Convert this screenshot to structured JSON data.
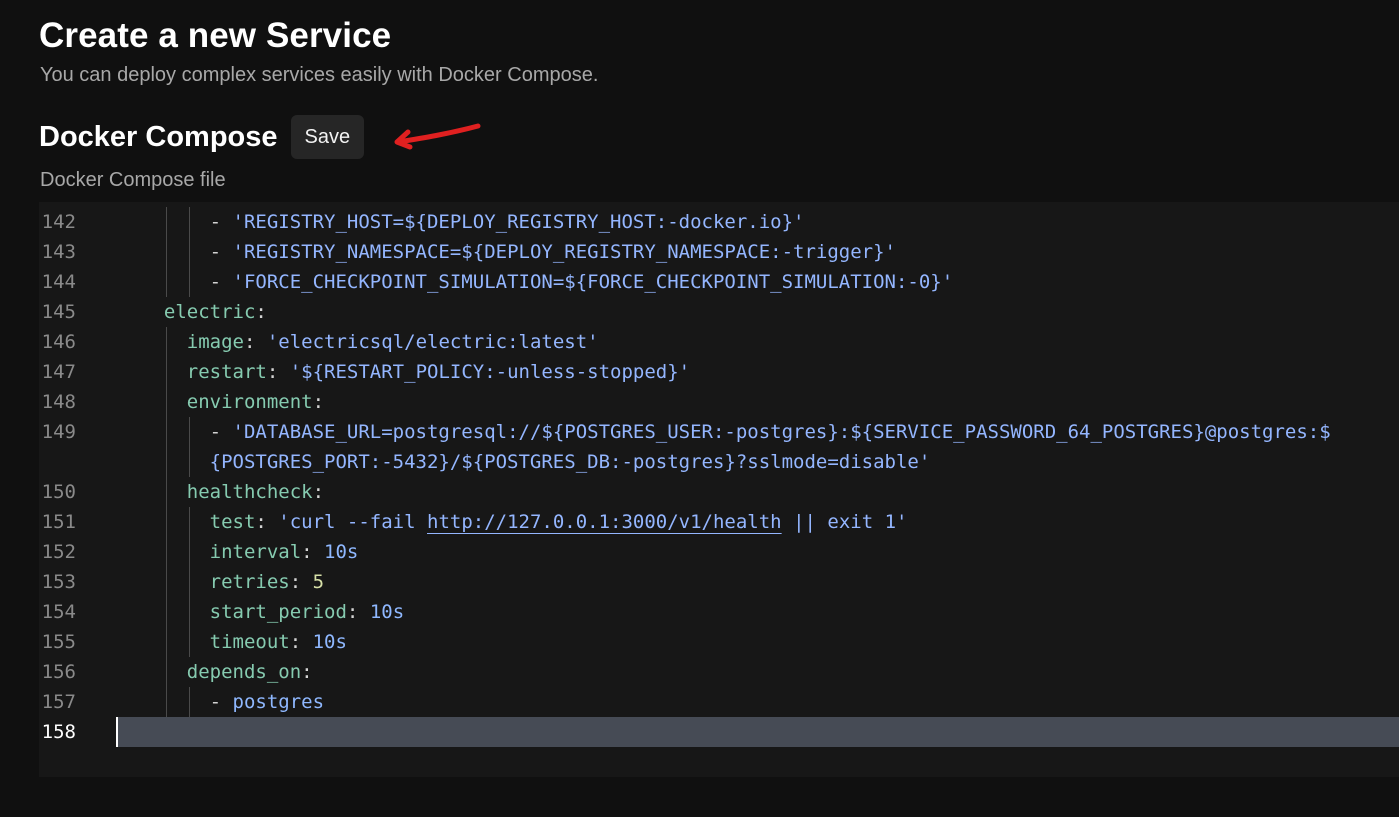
{
  "page": {
    "title": "Create a new Service",
    "subtitle": "You can deploy complex services easily with Docker Compose."
  },
  "section": {
    "title": "Docker Compose",
    "save_label": "Save",
    "annotation_color": "#e02020"
  },
  "editor": {
    "label": "Docker Compose file",
    "active_line": "158",
    "lines": [
      {
        "num": "142",
        "indent": "      ",
        "parts": [
          [
            "p",
            "- "
          ],
          [
            "s",
            "'REGISTRY_HOST=${DEPLOY_REGISTRY_HOST:-docker.io}'"
          ]
        ]
      },
      {
        "num": "143",
        "indent": "      ",
        "parts": [
          [
            "p",
            "- "
          ],
          [
            "s",
            "'REGISTRY_NAMESPACE=${DEPLOY_REGISTRY_NAMESPACE:-trigger}'"
          ]
        ]
      },
      {
        "num": "144",
        "indent": "      ",
        "parts": [
          [
            "p",
            "- "
          ],
          [
            "s",
            "'FORCE_CHECKPOINT_SIMULATION=${FORCE_CHECKPOINT_SIMULATION:-0}'"
          ]
        ]
      },
      {
        "num": "145",
        "indent": "  ",
        "parts": [
          [
            "k",
            "electric"
          ],
          [
            "p",
            ":"
          ]
        ]
      },
      {
        "num": "146",
        "indent": "    ",
        "parts": [
          [
            "k",
            "image"
          ],
          [
            "p",
            ": "
          ],
          [
            "s",
            "'electricsql/electric:latest'"
          ]
        ]
      },
      {
        "num": "147",
        "indent": "    ",
        "parts": [
          [
            "k",
            "restart"
          ],
          [
            "p",
            ": "
          ],
          [
            "s",
            "'${RESTART_POLICY:-unless-stopped}'"
          ]
        ]
      },
      {
        "num": "148",
        "indent": "    ",
        "parts": [
          [
            "k",
            "environment"
          ],
          [
            "p",
            ":"
          ]
        ]
      },
      {
        "num": "149",
        "indent": "      ",
        "parts": [
          [
            "p",
            "- "
          ],
          [
            "s",
            "'DATABASE_URL=postgresql://${POSTGRES_USER:-postgres}:${SERVICE_PASSWORD_64_POSTGRES}@postgres:$"
          ]
        ]
      },
      {
        "num": "",
        "indent": "      ",
        "parts": [
          [
            "s",
            "{POSTGRES_PORT:-5432}/${POSTGRES_DB:-postgres}?sslmode=disable'"
          ]
        ]
      },
      {
        "num": "150",
        "indent": "    ",
        "parts": [
          [
            "k",
            "healthcheck"
          ],
          [
            "p",
            ":"
          ]
        ]
      },
      {
        "num": "151",
        "indent": "      ",
        "parts": [
          [
            "k",
            "test"
          ],
          [
            "p",
            ": "
          ],
          [
            "s",
            "'curl --fail "
          ],
          [
            "su",
            "http://127.0.0.1:3000/v1/health"
          ],
          [
            "s",
            " || exit 1'"
          ]
        ]
      },
      {
        "num": "152",
        "indent": "      ",
        "parts": [
          [
            "k",
            "interval"
          ],
          [
            "p",
            ": "
          ],
          [
            "n",
            "10s"
          ]
        ]
      },
      {
        "num": "153",
        "indent": "      ",
        "parts": [
          [
            "k",
            "retries"
          ],
          [
            "p",
            ": "
          ],
          [
            "g",
            "5"
          ]
        ]
      },
      {
        "num": "154",
        "indent": "      ",
        "parts": [
          [
            "k",
            "start_period"
          ],
          [
            "p",
            ": "
          ],
          [
            "n",
            "10s"
          ]
        ]
      },
      {
        "num": "155",
        "indent": "      ",
        "parts": [
          [
            "k",
            "timeout"
          ],
          [
            "p",
            ": "
          ],
          [
            "n",
            "10s"
          ]
        ]
      },
      {
        "num": "156",
        "indent": "    ",
        "parts": [
          [
            "k",
            "depends_on"
          ],
          [
            "p",
            ":"
          ]
        ]
      },
      {
        "num": "157",
        "indent": "      ",
        "parts": [
          [
            "p",
            "- "
          ],
          [
            "n",
            "postgres"
          ]
        ]
      },
      {
        "num": "158",
        "indent": "",
        "parts": []
      }
    ]
  }
}
